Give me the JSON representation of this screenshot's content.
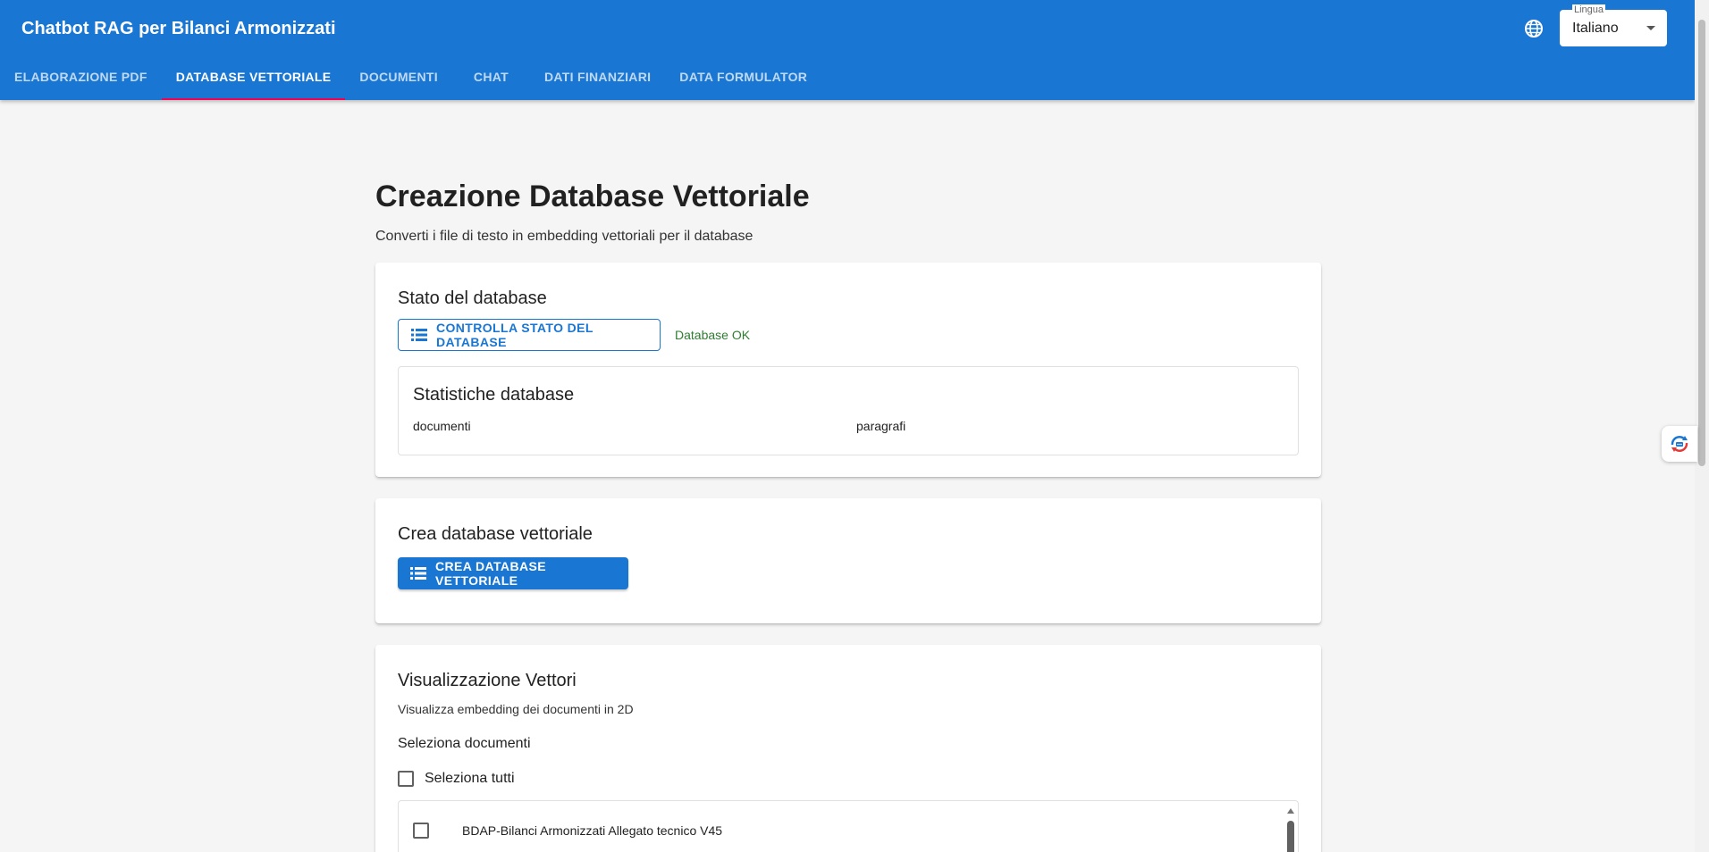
{
  "app": {
    "title": "Chatbot RAG per Bilanci Armonizzati"
  },
  "tabs": [
    {
      "label": "ELABORAZIONE PDF"
    },
    {
      "label": "DATABASE VETTORIALE",
      "active": true
    },
    {
      "label": "DOCUMENTI"
    },
    {
      "label": "CHAT"
    },
    {
      "label": "DATI FINANZIARI"
    },
    {
      "label": "DATA FORMULATOR"
    }
  ],
  "language": {
    "label": "Lingua",
    "value": "Italiano",
    "icon": "globe-icon"
  },
  "page": {
    "title": "Creazione Database Vettoriale",
    "subtitle": "Converti i file di testo in embedding vettoriali per il database"
  },
  "db_status": {
    "title": "Stato del database",
    "check_button": "CONTROLLA STATO DEL DATABASE",
    "check_icon": "list-icon",
    "status_text": "Database OK",
    "status_color": "#2e7d32",
    "stats": {
      "title": "Statistiche database",
      "documents_label": "documenti",
      "paragraphs_label": "paragrafi"
    }
  },
  "create_db": {
    "title": "Crea database vettoriale",
    "button": "CREA DATABASE VETTORIALE",
    "button_icon": "list-icon"
  },
  "visualization": {
    "title": "Visualizzazione Vettori",
    "description": "Visualizza embedding dei documenti in 2D",
    "select_label": "Seleziona documenti",
    "select_all": "Seleziona tutti",
    "documents": [
      {
        "name": "BDAP-Bilanci Armonizzati Allegato tecnico V45",
        "checked": false
      }
    ]
  },
  "colors": {
    "primary": "#1976d2",
    "tab_indicator": "#f50057",
    "background": "#f5f5f5"
  }
}
